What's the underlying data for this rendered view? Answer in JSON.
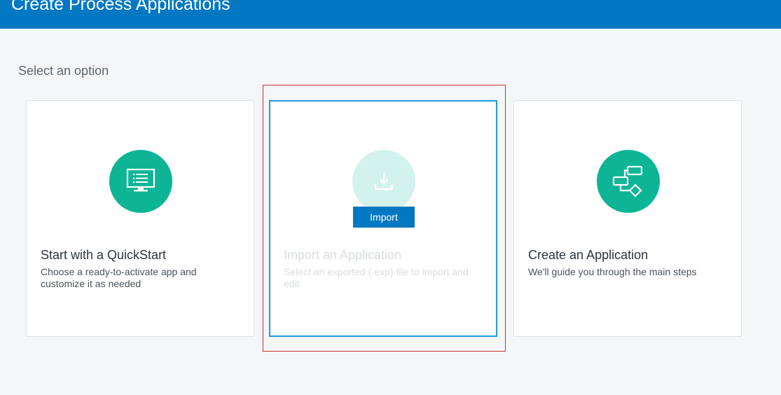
{
  "header": {
    "title": "Create Process Applications"
  },
  "page": {
    "subtitle": "Select an option"
  },
  "cards": [
    {
      "icon": "monitor-icon",
      "title": "Start with a QuickStart",
      "description": "Choose a ready-to-activate app and customize it as needed"
    },
    {
      "icon": "download-icon",
      "title": "Import an Application",
      "description": "Select an exported (.exp) file to import and edit",
      "button_label": "Import"
    },
    {
      "icon": "flowchart-icon",
      "title": "Create an Application",
      "description": "We'll guide you through the main steps"
    }
  ],
  "colors": {
    "header_bg": "#0278c2",
    "icon_green": "#0db596",
    "icon_green_light": "#d3f2ec",
    "selected_border": "#1c9ae6",
    "highlight_frame": "#cc2f3a"
  }
}
